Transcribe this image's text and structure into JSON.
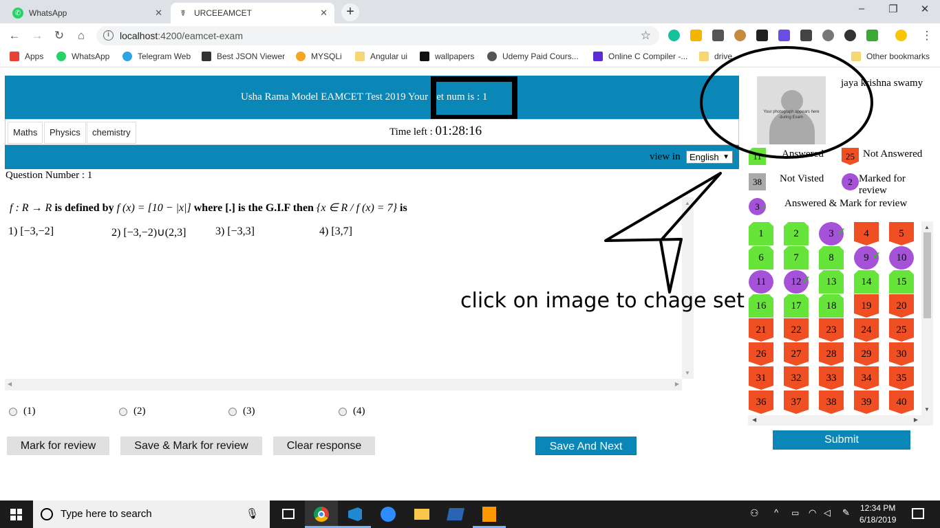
{
  "browser": {
    "tabs": [
      {
        "label": "WhatsApp",
        "active": false
      },
      {
        "label": "URCEEAMCET",
        "active": true
      }
    ],
    "new_tab": "+",
    "url_host": "localhost",
    "url_path": ":4200/eamcet-exam",
    "bookmarks": [
      "Apps",
      "WhatsApp",
      "Telegram Web",
      "Best JSON Viewer",
      "MYSQLi",
      "Angular ui",
      "wallpapers",
      "Udemy Paid Cours...",
      "Online C Compiler -...",
      "drive"
    ],
    "other_bookmarks": "Other bookmarks",
    "window_controls": [
      "–",
      "❐",
      "✕"
    ]
  },
  "exam": {
    "header_title": "Usha Rama Model EAMCET Test 2019 Your Set num is : 1",
    "subjects": [
      "Maths",
      "Physics",
      "chemistry"
    ],
    "time_label": "Time left : ",
    "time_value": "01:28:16",
    "view_in_label": "view in",
    "language": "English",
    "question_number_label": "Question Number : 1",
    "question": {
      "p1": "f : R → R",
      "p2": " is defined by ",
      "p3": "f (x) = [10 − |x|]",
      "p4": " where [.] is the G.I.F then ",
      "p5": "{x ∈ R / f (x) = 7}",
      "p6": " is"
    },
    "options": [
      "1) [−3,−2]",
      "2) [−3,−2)∪(2,3]",
      "3)  [−3,3]",
      "4) [3,7]"
    ],
    "radio_labels": [
      "(1)",
      "(2)",
      "(3)",
      "(4)"
    ],
    "buttons": {
      "mark_review": "Mark for review",
      "save_mark_review": "Save & Mark for review",
      "clear": "Clear response",
      "save_next": "Save And Next",
      "submit": "Submit"
    }
  },
  "candidate": {
    "name": "jaya krishna swamy",
    "photo_text": "Your photograph appears here during Exam"
  },
  "legend": {
    "answered_count": "11",
    "answered_label": "Answered",
    "not_answered_count": "25",
    "not_answered_label": "Not Answered",
    "not_visited_count": "38",
    "not_visited_label": "Not Visted",
    "marked_count": "2",
    "marked_label": "Marked for review",
    "ans_marked_count": "3",
    "ans_marked_label": "Answered & Mark for review"
  },
  "palette": [
    {
      "n": "1",
      "s": "green"
    },
    {
      "n": "2",
      "s": "green"
    },
    {
      "n": "3",
      "s": "purple-check"
    },
    {
      "n": "4",
      "s": "red"
    },
    {
      "n": "5",
      "s": "red"
    },
    {
      "n": "6",
      "s": "green"
    },
    {
      "n": "7",
      "s": "green"
    },
    {
      "n": "8",
      "s": "green"
    },
    {
      "n": "9",
      "s": "purple-check"
    },
    {
      "n": "10",
      "s": "purple"
    },
    {
      "n": "11",
      "s": "purple"
    },
    {
      "n": "12",
      "s": "purple-check"
    },
    {
      "n": "13",
      "s": "green"
    },
    {
      "n": "14",
      "s": "green"
    },
    {
      "n": "15",
      "s": "green"
    },
    {
      "n": "16",
      "s": "green"
    },
    {
      "n": "17",
      "s": "green"
    },
    {
      "n": "18",
      "s": "green"
    },
    {
      "n": "19",
      "s": "red"
    },
    {
      "n": "20",
      "s": "red"
    },
    {
      "n": "21",
      "s": "red"
    },
    {
      "n": "22",
      "s": "red"
    },
    {
      "n": "23",
      "s": "red"
    },
    {
      "n": "24",
      "s": "red"
    },
    {
      "n": "25",
      "s": "red"
    },
    {
      "n": "26",
      "s": "red"
    },
    {
      "n": "27",
      "s": "red"
    },
    {
      "n": "28",
      "s": "red"
    },
    {
      "n": "29",
      "s": "red"
    },
    {
      "n": "30",
      "s": "red"
    },
    {
      "n": "31",
      "s": "red"
    },
    {
      "n": "32",
      "s": "red"
    },
    {
      "n": "33",
      "s": "red"
    },
    {
      "n": "34",
      "s": "red"
    },
    {
      "n": "35",
      "s": "red"
    },
    {
      "n": "36",
      "s": "red"
    },
    {
      "n": "37",
      "s": "red"
    },
    {
      "n": "38",
      "s": "red"
    },
    {
      "n": "39",
      "s": "red"
    },
    {
      "n": "40",
      "s": "red"
    }
  ],
  "annotation": "click on image to chage set",
  "taskbar": {
    "search_placeholder": "Type here to search",
    "time": "12:34 PM",
    "date": "6/18/2019"
  },
  "colors": {
    "accent": "#0a87b6",
    "answered": "#67e43a",
    "not_answered": "#f04e23",
    "marked": "#a652d8",
    "not_visited": "#aaaaaa"
  }
}
